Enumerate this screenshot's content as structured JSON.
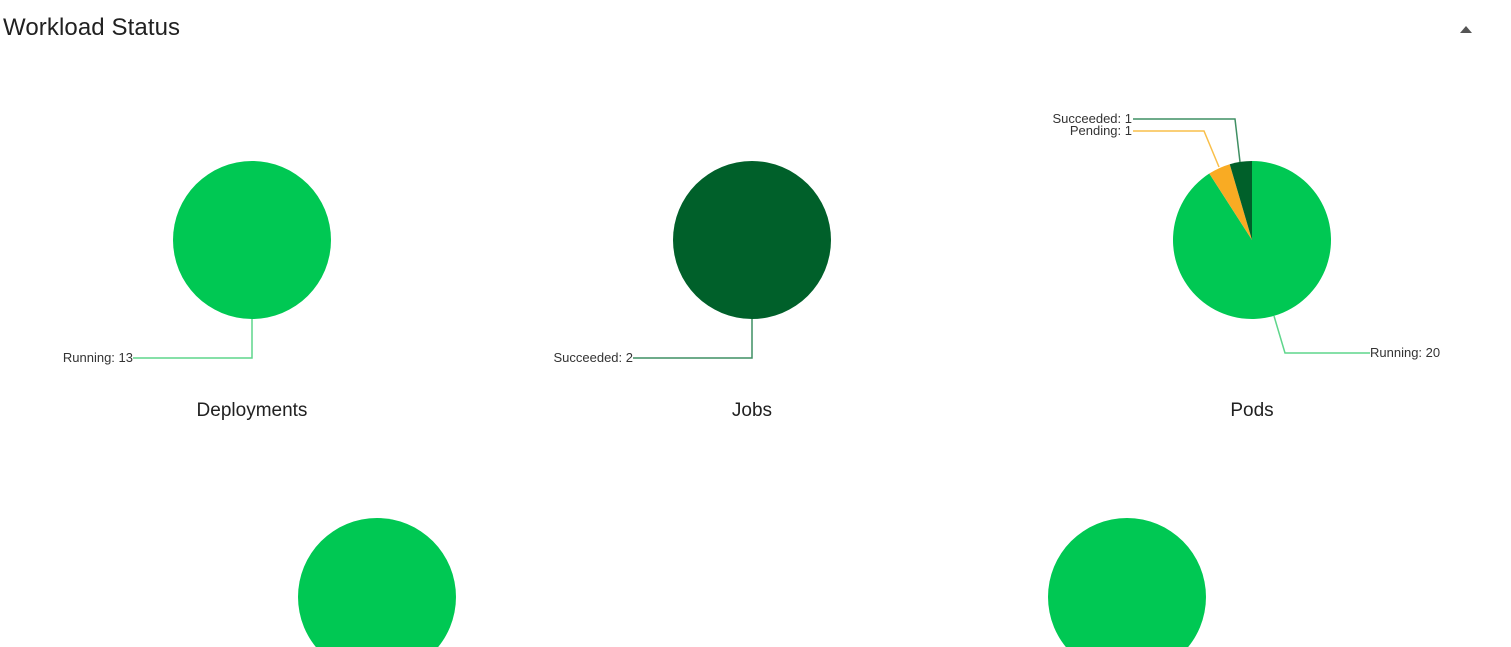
{
  "section": {
    "title": "Workload Status",
    "collapse_icon": "caret-up-icon"
  },
  "colors": {
    "running": "#00c853",
    "succeeded": "#00602a",
    "pending": "#f9ab23",
    "running_leader": "#5fd68c",
    "succeeded_leader": "#3f8f63",
    "pending_leader": "#f9bf4a"
  },
  "chart_data": [
    {
      "type": "pie",
      "title": "Deployments",
      "slices": [
        {
          "label": "Running: 13",
          "status": "running",
          "value": 13
        }
      ]
    },
    {
      "type": "pie",
      "title": "Jobs",
      "slices": [
        {
          "label": "Succeeded: 2",
          "status": "succeeded",
          "value": 2
        }
      ]
    },
    {
      "type": "pie",
      "title": "Pods",
      "slices": [
        {
          "label": "Running: 20",
          "status": "running",
          "value": 20
        },
        {
          "label": "Pending: 1",
          "status": "pending",
          "value": 1
        },
        {
          "label": "Succeeded: 1",
          "status": "succeeded",
          "value": 1
        }
      ]
    },
    {
      "type": "pie",
      "title": "",
      "slices": [
        {
          "label": "",
          "status": "running",
          "value": 1
        }
      ]
    },
    {
      "type": "pie",
      "title": "",
      "slices": [
        {
          "label": "",
          "status": "running",
          "value": 1
        }
      ]
    }
  ]
}
